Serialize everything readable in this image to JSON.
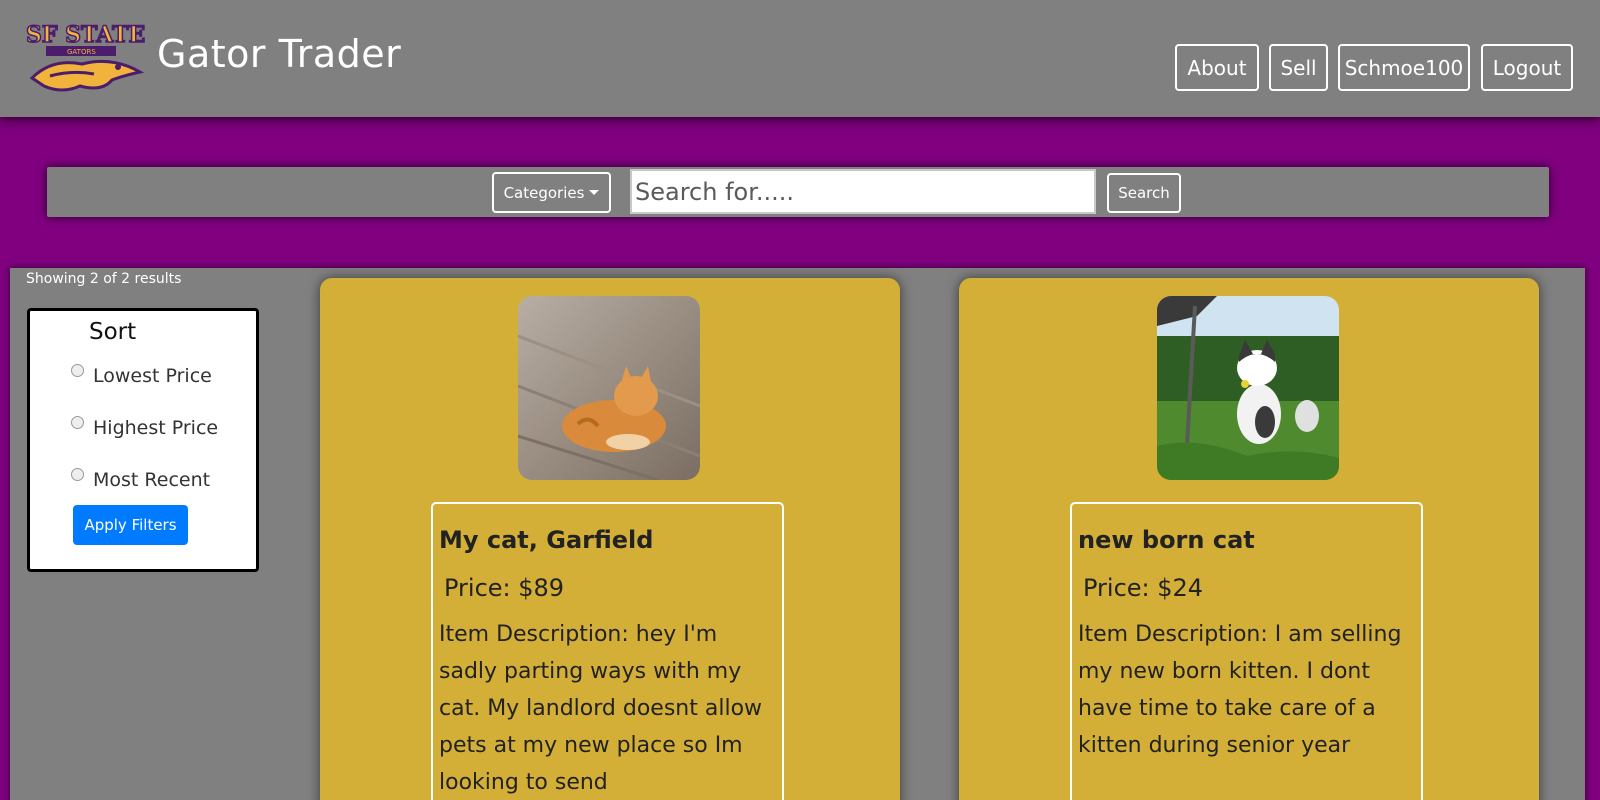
{
  "header": {
    "logo_text": "SF STATE GATORS",
    "brand": "Gator Trader",
    "nav": {
      "about": "About",
      "sell": "Sell",
      "user": "Schmoe100",
      "logout": "Logout"
    }
  },
  "search": {
    "categories_label": "Categories",
    "placeholder": "Search for.....",
    "button_label": "Search"
  },
  "results": {
    "summary": "Showing 2 of 2 results"
  },
  "sort": {
    "title": "Sort",
    "options": [
      "Lowest Price",
      "Highest Price",
      "Most Recent"
    ],
    "apply_label": "Apply Filters"
  },
  "items": [
    {
      "title": "My cat, Garfield",
      "price": "Price: $89",
      "description": "Item Description: hey I'm sadly parting ways with my cat. My landlord doesnt allow pets at my new place so Im looking to send"
    },
    {
      "title": "new born cat",
      "price": "Price: $24",
      "description": "Item Description: I am selling my new born kitten. I dont have time to take care of a kitten during senior year"
    }
  ],
  "colors": {
    "page_bg": "#800080",
    "bar_gray": "#808080",
    "card_gold": "#d4af37",
    "apply_blue": "#007bff"
  }
}
